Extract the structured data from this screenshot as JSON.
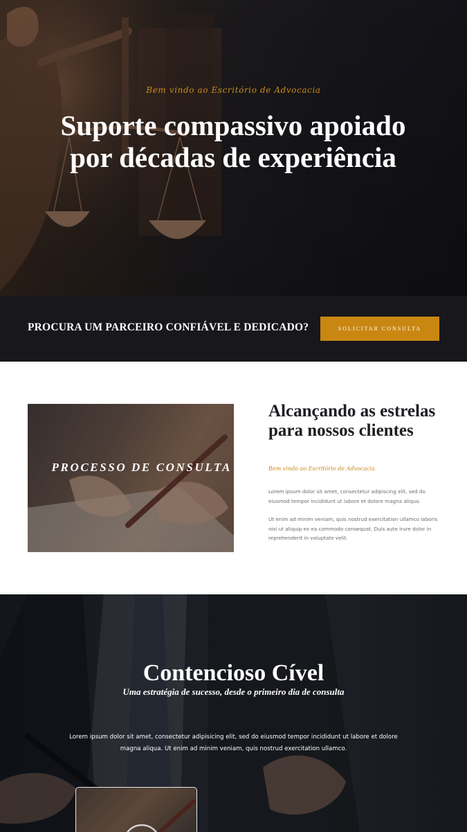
{
  "hero": {
    "kicker": "Bem vindo ao Escritório de Advocacia",
    "title": "Suporte compassivo apoiado por décadas de experiência"
  },
  "cta": {
    "text": "PROCURA UM PARCEIRO CONFIÁVEL E DEDICADO?",
    "button_label": "SOLICITAR CONSULTA"
  },
  "about": {
    "image_caption": "PROCESSO DE CONSULTA",
    "title": "Alcançando as estrelas para nossos clientes",
    "kicker": "Bem vindo ao Escritório de Advocacia",
    "paragraph1": "Lorem ipsum dolor sit amet, consectetur adipiscing elit, sed do eiusmod tempor incididunt ut labore et dolore magna aliqua.",
    "paragraph2": "Ut enim ad minim veniam, quis nostrud exercitation ullamco laboris nisi ut aliquip ex ea commodo consequat. Duis aute irure dolor in reprehenderit in voluptate velit."
  },
  "service": {
    "title": "Contencioso Cível",
    "subtitle": "Uma estratégia de sucesso, desde o primeiro dia de consulta",
    "text": "Lorem ipsum dolor sit amet, consectetur adipisicing elit, sed do eiusmod tempor incididunt ut labore et dolore magna aliqua. Ut enim ad minim veniam, quis nostrud exercitation ullamco."
  },
  "colors": {
    "accent": "#c98712",
    "dark_band": "#18171c",
    "heading_dark": "#1e1d22",
    "body_text": "#6a6a72"
  }
}
